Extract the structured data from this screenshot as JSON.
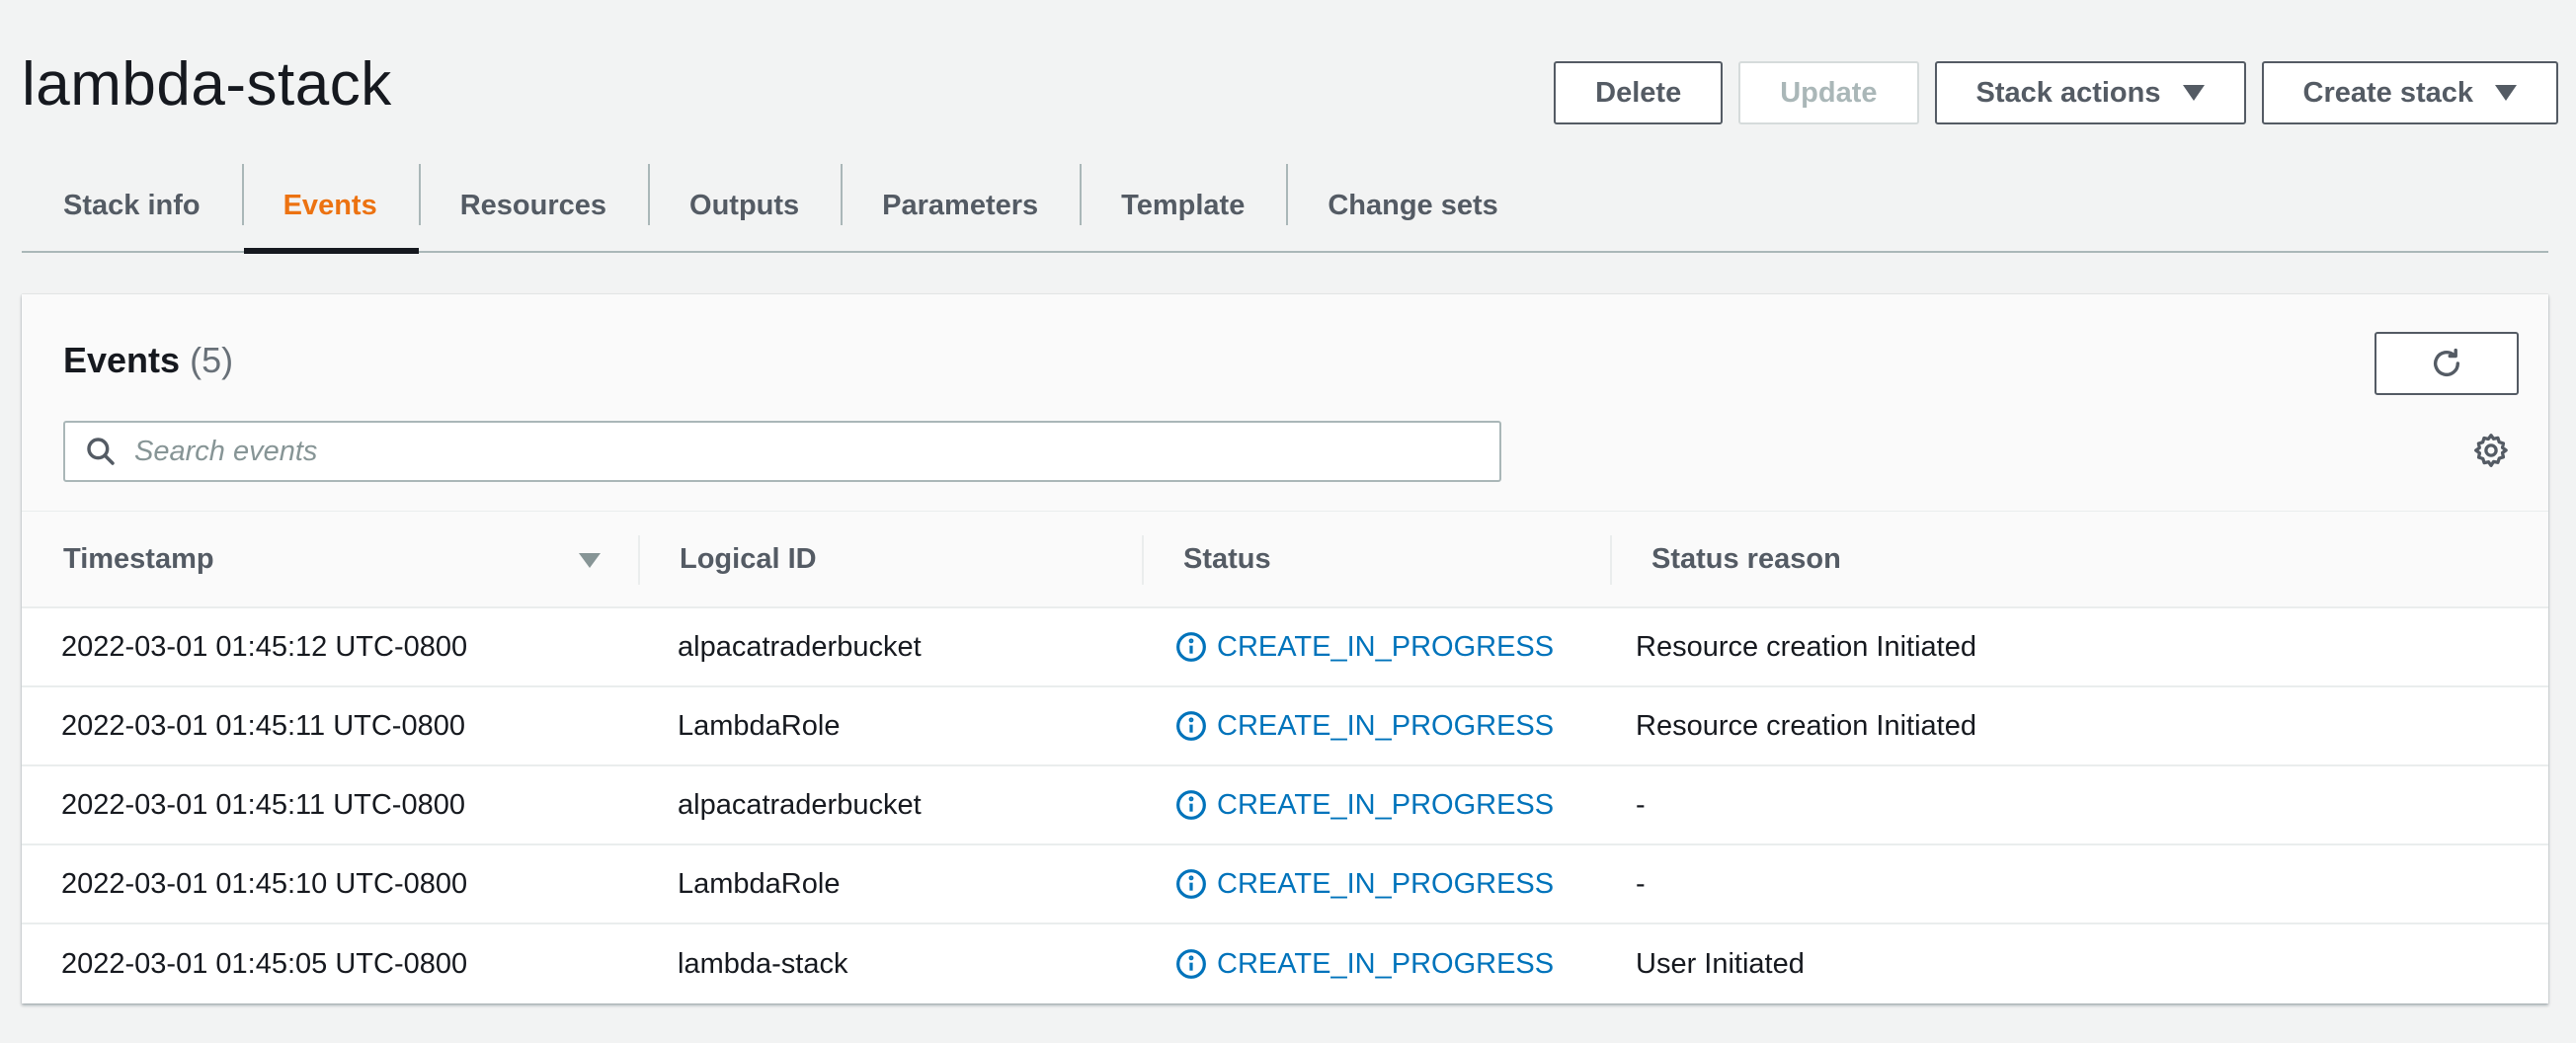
{
  "header": {
    "title": "lambda-stack",
    "buttons": {
      "delete": "Delete",
      "update": "Update",
      "stack_actions": "Stack actions",
      "create_stack": "Create stack"
    }
  },
  "tabs": [
    {
      "label": "Stack info",
      "active": false
    },
    {
      "label": "Events",
      "active": true
    },
    {
      "label": "Resources",
      "active": false
    },
    {
      "label": "Outputs",
      "active": false
    },
    {
      "label": "Parameters",
      "active": false
    },
    {
      "label": "Template",
      "active": false
    },
    {
      "label": "Change sets",
      "active": false
    }
  ],
  "events": {
    "title": "Events",
    "count": "(5)",
    "search_placeholder": "Search events",
    "search_value": "",
    "columns": [
      "Timestamp",
      "Logical ID",
      "Status",
      "Status reason"
    ],
    "rows": [
      {
        "timestamp": "2022-03-01 01:45:12 UTC-0800",
        "logical_id": "alpacatraderbucket",
        "status": "CREATE_IN_PROGRESS",
        "reason": "Resource creation Initiated"
      },
      {
        "timestamp": "2022-03-01 01:45:11 UTC-0800",
        "logical_id": "LambdaRole",
        "status": "CREATE_IN_PROGRESS",
        "reason": "Resource creation Initiated"
      },
      {
        "timestamp": "2022-03-01 01:45:11 UTC-0800",
        "logical_id": "alpacatraderbucket",
        "status": "CREATE_IN_PROGRESS",
        "reason": "-"
      },
      {
        "timestamp": "2022-03-01 01:45:10 UTC-0800",
        "logical_id": "LambdaRole",
        "status": "CREATE_IN_PROGRESS",
        "reason": "-"
      },
      {
        "timestamp": "2022-03-01 01:45:05 UTC-0800",
        "logical_id": "lambda-stack",
        "status": "CREATE_IN_PROGRESS",
        "reason": "User Initiated"
      }
    ]
  },
  "colors": {
    "accent_tab": "#ec7211",
    "status_link": "#0073bb",
    "background": "#f2f3f3"
  },
  "icons": {
    "refresh": "refresh-icon",
    "search": "search-icon",
    "settings": "gear-icon",
    "status": "info-icon",
    "sort": "caret-down-icon"
  }
}
